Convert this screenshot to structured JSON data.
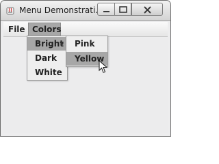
{
  "window": {
    "title": "Menu Demonstrati..."
  },
  "title_icons": {
    "app": "java-cup-icon",
    "minimize": "minimize-icon",
    "maximize": "maximize-icon",
    "close": "close-icon"
  },
  "menubar": {
    "items": [
      {
        "label": "File"
      },
      {
        "label": "Colors"
      }
    ]
  },
  "colors_menu": {
    "items": [
      {
        "label": "Bright"
      },
      {
        "label": "Dark"
      },
      {
        "label": "White"
      }
    ]
  },
  "bright_submenu": {
    "items": [
      {
        "label": "Pink"
      },
      {
        "label": "Yellow"
      }
    ]
  },
  "pointer": {
    "icon": "mouse-pointer-icon"
  },
  "theme": {
    "highlight": "#a7a7a7",
    "menu_bg": "#eeeeee",
    "window_bg": "#ececed"
  }
}
